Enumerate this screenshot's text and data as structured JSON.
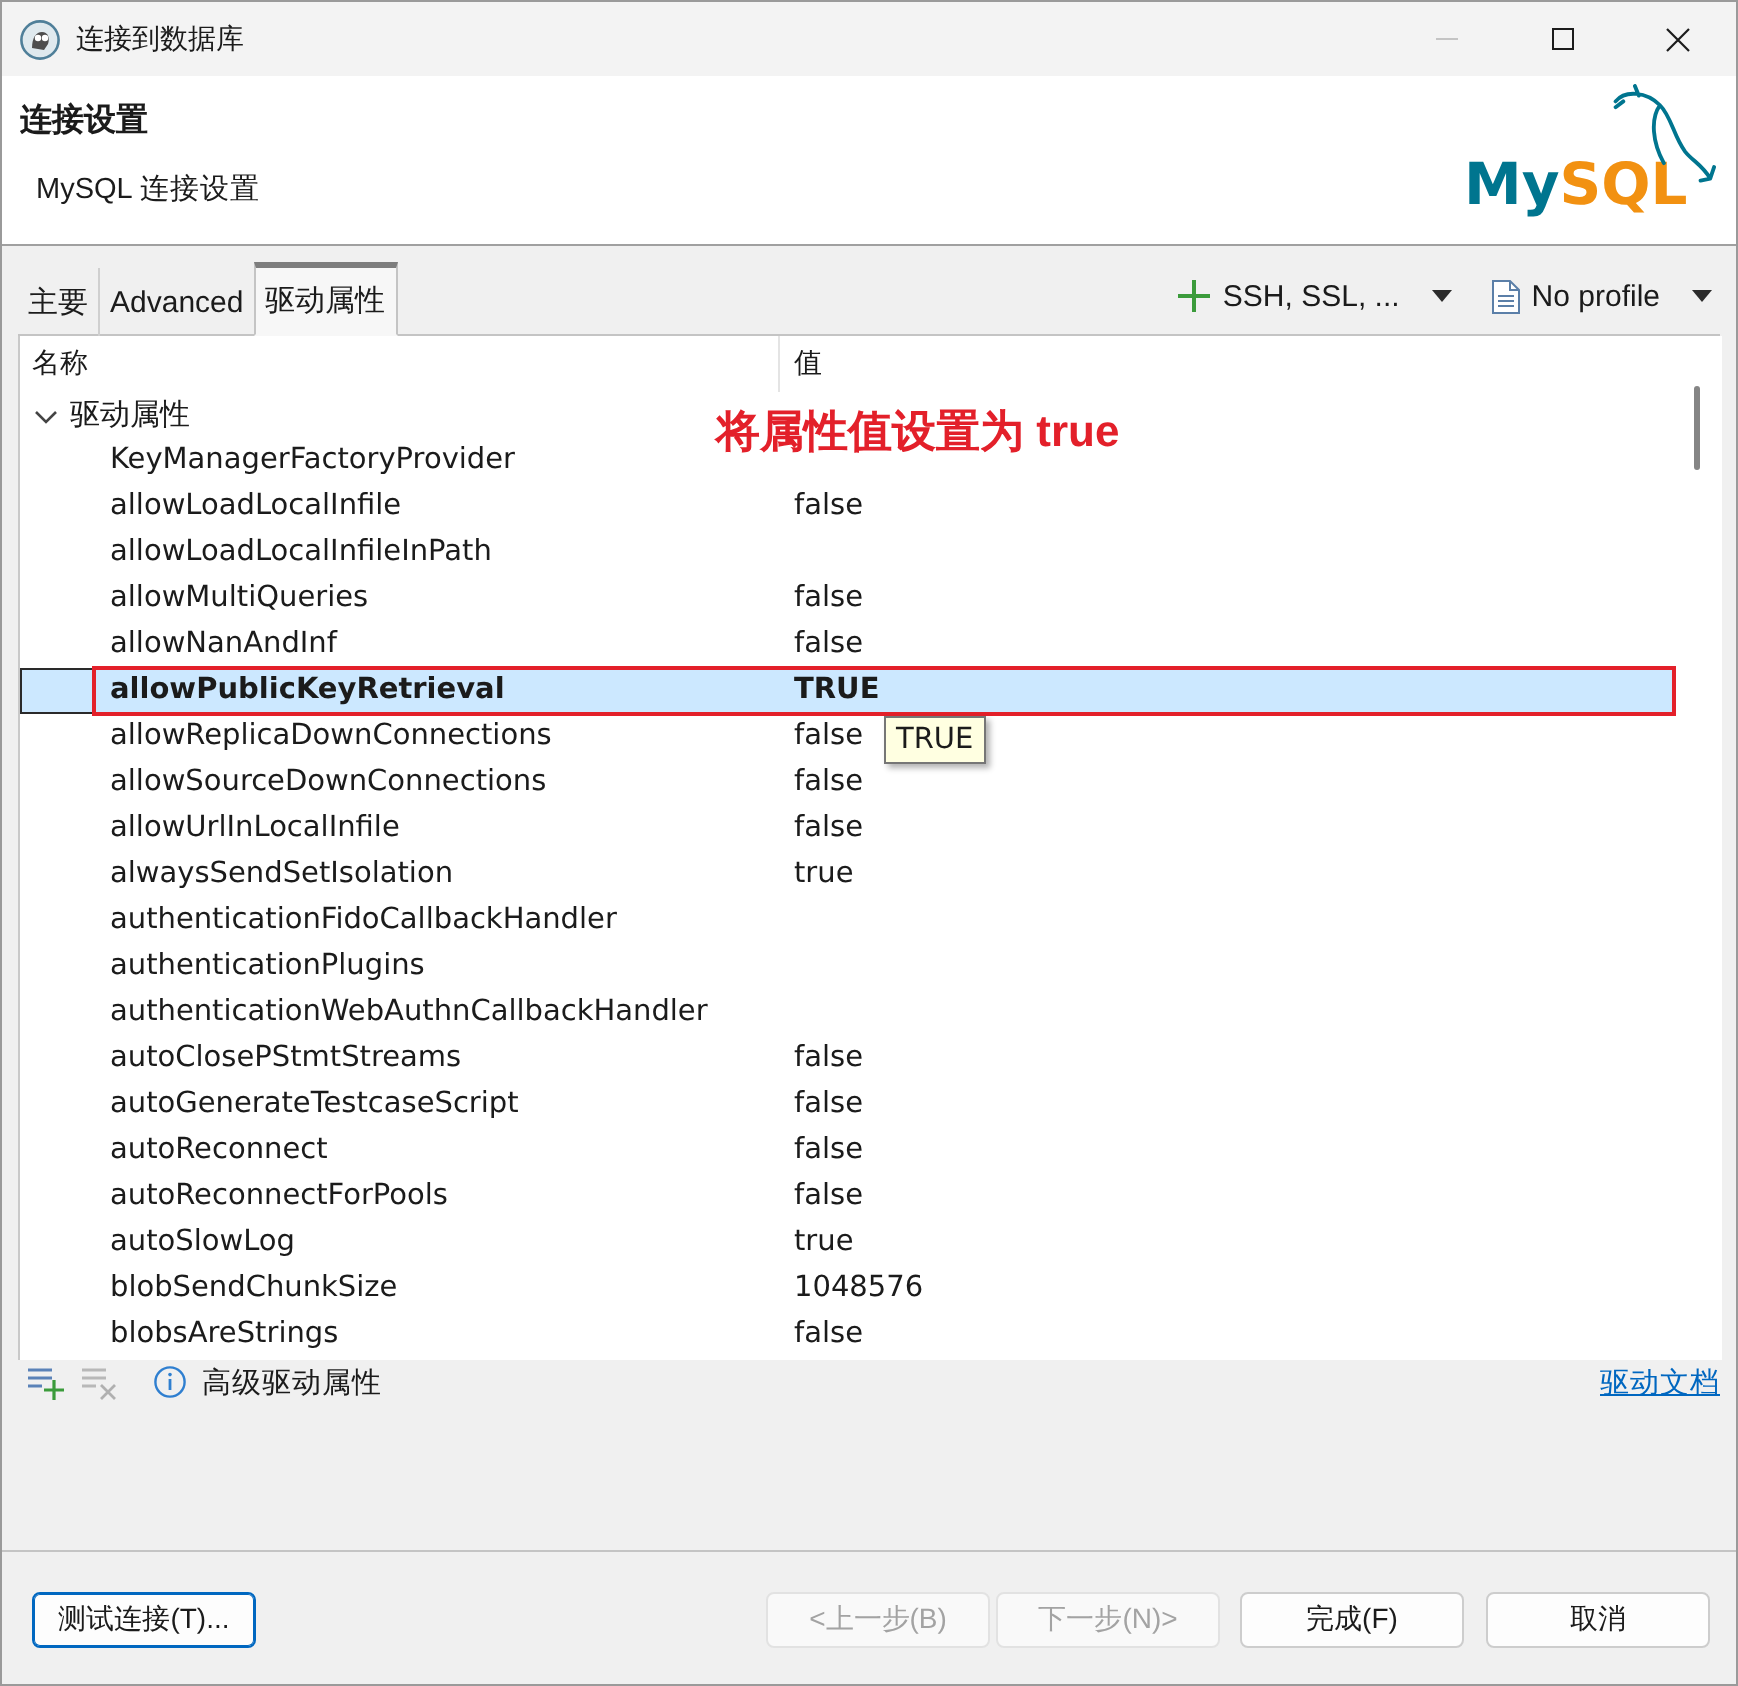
{
  "window": {
    "title": "连接到数据库",
    "controls": [
      {
        "kind": "minimize",
        "disabled": true
      },
      {
        "kind": "maximize",
        "disabled": false
      },
      {
        "kind": "close",
        "disabled": false
      }
    ]
  },
  "header": {
    "title": "连接设置",
    "subtitle": "MySQL 连接设置",
    "logo": {
      "parts": [
        {
          "text": "My",
          "color": "#00758f"
        },
        {
          "text": "SQL",
          "color": "#f29111"
        }
      ]
    }
  },
  "tabs": [
    {
      "label": "主要",
      "selected": false
    },
    {
      "label": "Advanced",
      "selected": false
    },
    {
      "label": "驱动属性",
      "selected": true
    }
  ],
  "toolbar": [
    {
      "kind": "add",
      "label": "SSH, SSL, ..."
    },
    {
      "kind": "document",
      "label": "No profile"
    }
  ],
  "table": {
    "columns": [
      "名称",
      "值"
    ],
    "rows": [
      {
        "label": "驱动属性",
        "expanded": true,
        "children": [
          {
            "name": "KeyManagerFactoryProvider",
            "selected": false,
            "changed": false,
            "highlighted": false
          },
          {
            "name": "allowLoadLocalInfile",
            "value": "false",
            "selected": false,
            "changed": false,
            "highlighted": false
          },
          {
            "name": "allowLoadLocalInfileInPath",
            "selected": false,
            "changed": false,
            "highlighted": false
          },
          {
            "name": "allowMultiQueries",
            "value": "false",
            "selected": false,
            "changed": false,
            "highlighted": false
          },
          {
            "name": "allowNanAndInf",
            "value": "false",
            "selected": false,
            "changed": false,
            "highlighted": false
          },
          {
            "name": "allowPublicKeyRetrieval",
            "value": "TRUE",
            "selected": true,
            "changed": true,
            "highlighted": true
          },
          {
            "name": "allowReplicaDownConnections",
            "value": "false",
            "selected": false,
            "changed": false,
            "highlighted": false
          },
          {
            "name": "allowSourceDownConnections",
            "value": "false",
            "selected": false,
            "changed": false,
            "highlighted": false
          },
          {
            "name": "allowUrlInLocalInfile",
            "value": "false",
            "selected": false,
            "changed": false,
            "highlighted": false
          },
          {
            "name": "alwaysSendSetIsolation",
            "value": "true",
            "selected": false,
            "changed": false,
            "highlighted": false
          },
          {
            "name": "authenticationFidoCallbackHandler",
            "selected": false,
            "changed": false,
            "highlighted": false
          },
          {
            "name": "authenticationPlugins",
            "selected": false,
            "changed": false,
            "highlighted": false
          },
          {
            "name": "authenticationWebAuthnCallbackHandler",
            "selected": false,
            "changed": false,
            "highlighted": false
          },
          {
            "name": "autoClosePStmtStreams",
            "value": "false",
            "selected": false,
            "changed": false,
            "highlighted": false
          },
          {
            "name": "autoGenerateTestcaseScript",
            "value": "false",
            "selected": false,
            "changed": false,
            "highlighted": false
          },
          {
            "name": "autoReconnect",
            "value": "false",
            "selected": false,
            "changed": false,
            "highlighted": false
          },
          {
            "name": "autoReconnectForPools",
            "value": "false",
            "selected": false,
            "changed": false,
            "highlighted": false
          },
          {
            "name": "autoSlowLog",
            "value": "true",
            "selected": false,
            "changed": false,
            "highlighted": false
          },
          {
            "name": "blobSendChunkSize",
            "value": "1048576",
            "selected": false,
            "changed": false,
            "highlighted": false
          },
          {
            "name": "blobsAreStrings",
            "value": "false",
            "selected": false,
            "changed": false,
            "highlighted": false
          }
        ]
      }
    ]
  },
  "annotation": {
    "text": "将属性值设置为 true"
  },
  "tooltip": {
    "text": "TRUE"
  },
  "footer": {
    "tools": [
      {
        "kind": "add",
        "disabled": false
      },
      {
        "kind": "remove",
        "disabled": true
      }
    ],
    "info": "高级驱动属性",
    "link": "驱动文档"
  },
  "buttons": {
    "left": [
      {
        "label": "测试连接(T)...",
        "disabled": false,
        "focused": true
      }
    ],
    "nav": [
      {
        "label": "<上一步(B)",
        "disabled": true,
        "focused": false
      },
      {
        "label": "下一步(N)>",
        "disabled": true,
        "focused": false
      }
    ],
    "right": [
      {
        "label": "完成(F)",
        "disabled": false,
        "focused": false
      },
      {
        "label": "取消",
        "disabled": false,
        "focused": false
      }
    ]
  }
}
